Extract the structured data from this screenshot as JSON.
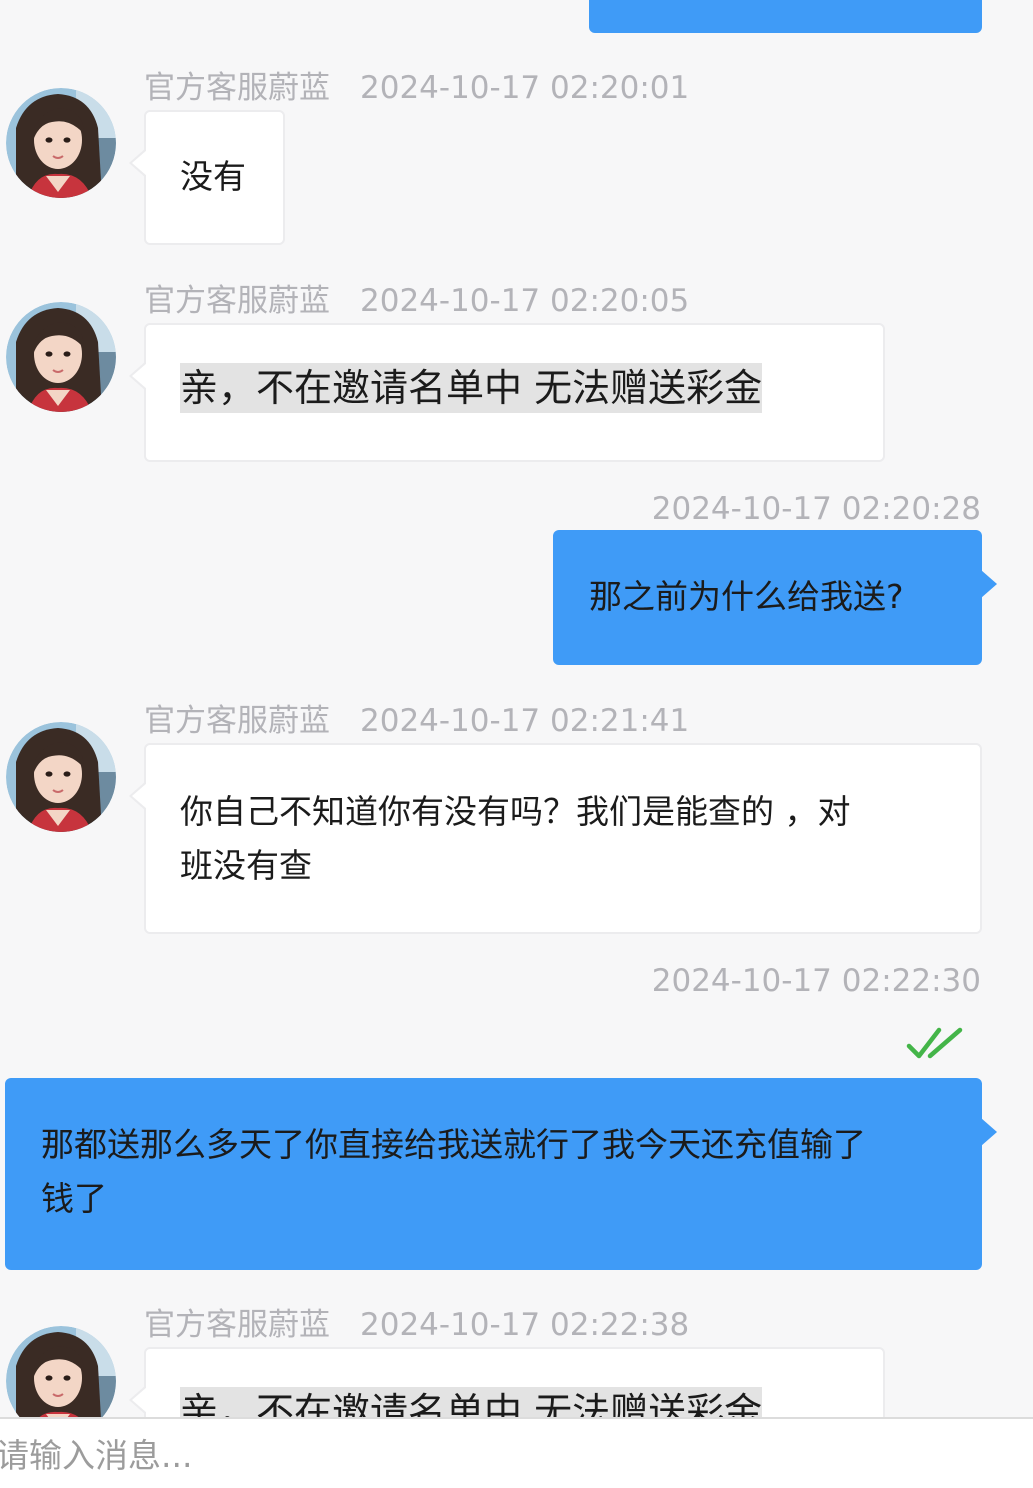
{
  "messages": [
    {
      "direction": "out",
      "text": "",
      "time": ""
    },
    {
      "direction": "in",
      "sender": "官方客服蔚蓝",
      "time": "2024-10-17 02:20:01",
      "text": "没有"
    },
    {
      "direction": "in",
      "sender": "官方客服蔚蓝",
      "time": "2024-10-17 02:20:05",
      "text": "亲，不在邀请名单中 无法赠送彩金"
    },
    {
      "direction": "out",
      "time": "2024-10-17 02:20:28",
      "text": "那之前为什么给我送?"
    },
    {
      "direction": "in",
      "sender": "官方客服蔚蓝",
      "time": "2024-10-17 02:21:41",
      "lines": [
        "你自己不知道你有没有吗？我们是能查的 ，对",
        "班没有查"
      ]
    },
    {
      "direction": "out",
      "time": "2024-10-17 02:22:30",
      "status": "read",
      "lines": [
        "那都送那么多天了你直接给我送就行了我今天还充值输了",
        "钱了"
      ]
    },
    {
      "direction": "in",
      "sender": "官方客服蔚蓝",
      "time": "2024-10-17 02:22:38",
      "text": "亲，不在邀请名单中 无法赠送彩金"
    }
  ],
  "input": {
    "placeholder": "请输入消息..."
  },
  "colors": {
    "outgoing_bubble": "#3f9bf7",
    "incoming_bubble": "#ffffff",
    "read_check": "#44b549",
    "meta_text": "#b3b3b8"
  },
  "icons": {
    "avatar": "agent-avatar",
    "read_receipt": "double-check-icon"
  }
}
